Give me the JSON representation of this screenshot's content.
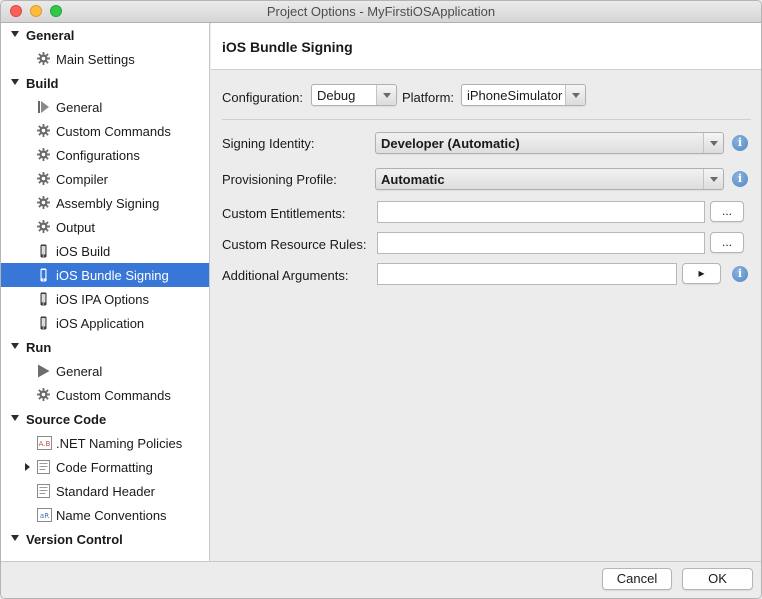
{
  "window": {
    "title": "Project Options - MyFirstiOSApplication"
  },
  "sidebar": {
    "groups": [
      {
        "label": "General",
        "items": [
          {
            "label": "Main Settings",
            "icon": "gear-icon"
          }
        ]
      },
      {
        "label": "Build",
        "items": [
          {
            "label": "General",
            "icon": "build-play-icon"
          },
          {
            "label": "Custom Commands",
            "icon": "gear-icon"
          },
          {
            "label": "Configurations",
            "icon": "gear-icon"
          },
          {
            "label": "Compiler",
            "icon": "gear-icon"
          },
          {
            "label": "Assembly Signing",
            "icon": "gear-icon"
          },
          {
            "label": "Output",
            "icon": "gear-icon"
          },
          {
            "label": "iOS Build",
            "icon": "iphone-icon"
          },
          {
            "label": "iOS Bundle Signing",
            "icon": "iphone-icon",
            "selected": true
          },
          {
            "label": "iOS IPA Options",
            "icon": "iphone-icon"
          },
          {
            "label": "iOS Application",
            "icon": "iphone-icon"
          }
        ]
      },
      {
        "label": "Run",
        "items": [
          {
            "label": "General",
            "icon": "play-icon"
          },
          {
            "label": "Custom Commands",
            "icon": "gear-icon"
          }
        ]
      },
      {
        "label": "Source Code",
        "items": [
          {
            "label": ".NET Naming Policies",
            "icon": "naming-policy-icon"
          },
          {
            "label": "Code Formatting",
            "icon": "document-icon",
            "expandable": true
          },
          {
            "label": "Standard Header",
            "icon": "document-icon"
          },
          {
            "label": "Name Conventions",
            "icon": "name-convention-icon"
          }
        ]
      },
      {
        "label": "Version Control",
        "items": []
      }
    ]
  },
  "main": {
    "heading": "iOS Bundle Signing",
    "configuration_label": "Configuration:",
    "configuration_value": "Debug",
    "platform_label": "Platform:",
    "platform_value": "iPhoneSimulator",
    "signing_identity_label": "Signing Identity:",
    "signing_identity_value": "Developer (Automatic)",
    "provisioning_profile_label": "Provisioning Profile:",
    "provisioning_profile_value": "Automatic",
    "custom_entitlements_label": "Custom Entitlements:",
    "custom_entitlements_value": "",
    "custom_resource_rules_label": "Custom Resource Rules:",
    "custom_resource_rules_value": "",
    "additional_arguments_label": "Additional Arguments:",
    "additional_arguments_value": "",
    "browse_label": "...",
    "run_label": "▸",
    "info_glyph": "i"
  },
  "footer": {
    "cancel_label": "Cancel",
    "ok_label": "OK"
  },
  "colors": {
    "selection": "#3876d8",
    "info": "#4f87c2"
  }
}
